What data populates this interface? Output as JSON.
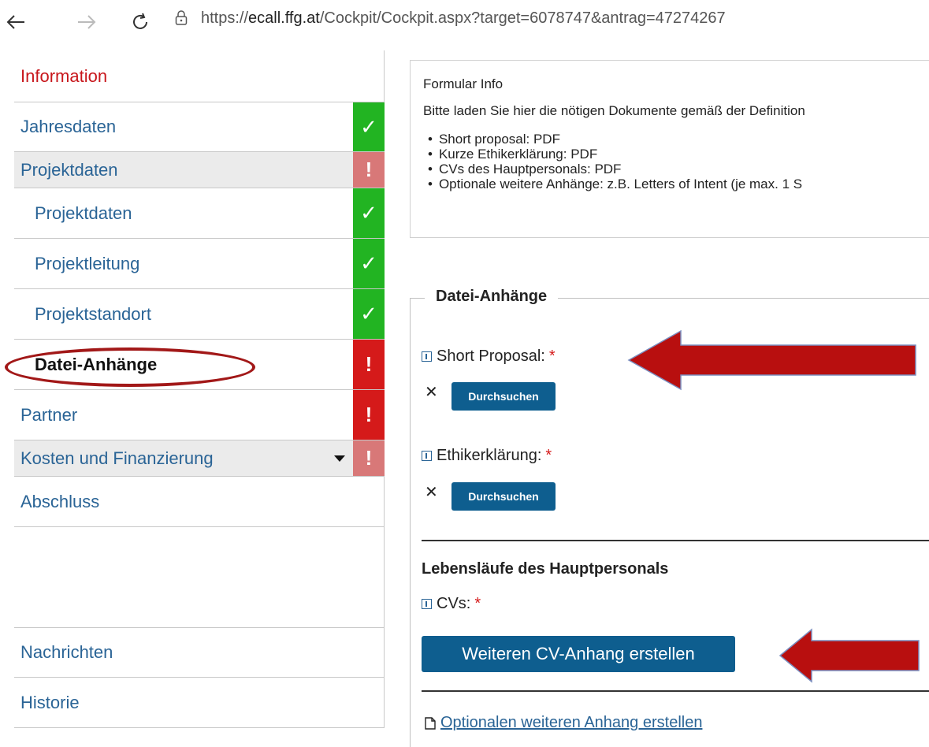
{
  "browser": {
    "url_prefix": "https://",
    "url_host": "ecall.ffg.at",
    "url_path": "/Cockpit/Cockpit.aspx?target=6078747&antrag=47274267"
  },
  "sidebar": {
    "heading": "Information",
    "items": [
      {
        "label": "Jahresdaten",
        "status": "ok"
      },
      {
        "label": "Projektdaten",
        "status": "err-light"
      },
      {
        "label": "Projektdaten",
        "status": "ok"
      },
      {
        "label": "Projektleitung",
        "status": "ok"
      },
      {
        "label": "Projektstandort",
        "status": "ok"
      },
      {
        "label": "Datei-Anhänge",
        "status": "err"
      },
      {
        "label": "Partner",
        "status": "err"
      },
      {
        "label": "Kosten und Finanzierung",
        "status": "err-light"
      },
      {
        "label": "Abschluss"
      },
      {
        "label": "Nachrichten"
      },
      {
        "label": "Historie"
      }
    ],
    "status_ok_glyph": "✓",
    "status_err_glyph": "!"
  },
  "info_box": {
    "title": "Formular Info",
    "text": "Bitte laden Sie hier die nötigen Dokumente gemäß der Definition",
    "bullets": [
      "Short proposal: PDF",
      "Kurze Ethikerklärung: PDF",
      "CVs des Hauptpersonals: PDF",
      "Optionale weitere Anhänge: z.B. Letters of Intent (je max. 1 S"
    ]
  },
  "attachments": {
    "legend": "Datei-Anhänge",
    "short_proposal_label": "Short Proposal:",
    "ethics_label": "Ethikerklärung:",
    "required_mark": "*",
    "remove_glyph": "✕",
    "browse_label": "Durchsuchen",
    "cv_section_title": "Lebensläufe des Hauptpersonals",
    "cv_label": "CVs:",
    "add_cv_button": "Weiteren CV-Anhang erstellen",
    "optional_link": "Optionalen weiteren Anhang erstellen"
  },
  "colors": {
    "ok": "#22b422",
    "err": "#d51a1a",
    "err_light": "#d87878",
    "primary": "#0e5e8f",
    "annotation": "#a21818"
  }
}
